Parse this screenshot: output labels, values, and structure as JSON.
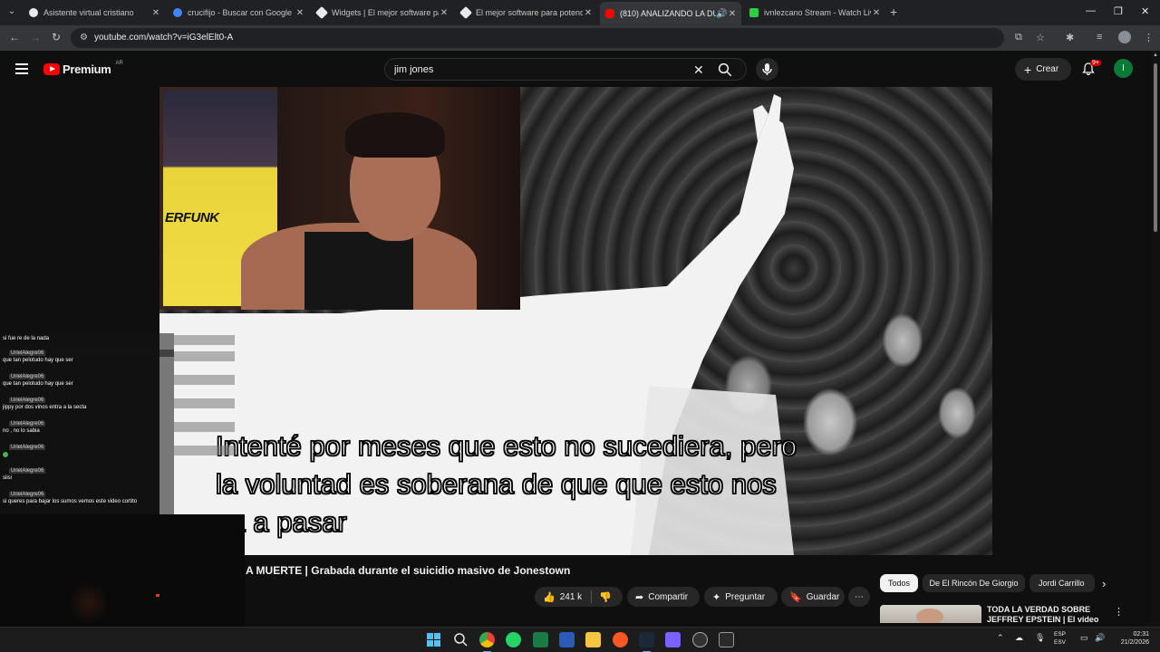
{
  "browser": {
    "tabs": [
      {
        "title": "Asistente virtual cristiano",
        "favicon_color": "#e8eaed"
      },
      {
        "title": "crucifijo - Buscar con Google",
        "favicon_color": "#4285f4"
      },
      {
        "title": "Widgets | El mejor software pa",
        "favicon_color": "#e8eaed"
      },
      {
        "title": "El mejor software para potencia",
        "favicon_color": "#e8eaed"
      },
      {
        "title": "(810) ANALIZANDO LA DU",
        "favicon_color": "#ff0000"
      },
      {
        "title": "ivnlezcano Stream - Watch Live",
        "favicon_color": "#2ecc40"
      }
    ],
    "new_tab": "+",
    "url": "youtube.com/watch?v=iG3elElt0-A"
  },
  "header": {
    "logo_text": "Premium",
    "country": "AR",
    "search_value": "jim jones",
    "create_label": "Crear",
    "notifications_badge": "9+",
    "avatar_letter": "I"
  },
  "player": {
    "overlay_brand": "ERFUNK",
    "subtitle_lines": [
      "Intenté por meses que esto no sucediera, pero",
      "la voluntad es soberana de que que esto nos",
      "va a pasar"
    ]
  },
  "chat": {
    "first_message": "si fue re de la nada",
    "messages": [
      {
        "user": "UrielAlegre06",
        "text": "que tan pelotudo hay que ser"
      },
      {
        "user": "UrielAlegre06",
        "text": "que tan pelotudo hay que ser"
      },
      {
        "user": "UrielAlegre06",
        "text": "jippy por dos vinos entra a la secta"
      },
      {
        "user": "UrielAlegre06",
        "text": "no , no lo sabia"
      },
      {
        "user": "UrielAlegre06",
        "text": ""
      },
      {
        "user": "UrielAlegre06",
        "text": "siisi"
      },
      {
        "user": "UrielAlegre06",
        "text": "si queres para bajar los sumos vemos este video cortito"
      }
    ]
  },
  "video": {
    "title": "A MUERTE | Grabada durante el suicidio masivo de Jonestown",
    "likes": "241 k",
    "share_label": "Compartir",
    "ask_label": "Preguntar",
    "save_label": "Guardar"
  },
  "sidebar": {
    "chips": [
      "Todos",
      "De El Rincón De Giorgio",
      "Jordi Carrillo"
    ],
    "recommendation_title": "TODA LA VERDAD SOBRE JEFFREY EPSTEIN | El video"
  },
  "taskbar": {
    "lang_top": "ESP",
    "lang_bottom": "ESV",
    "time": "02:31",
    "date": "21/2/2026"
  },
  "colors": {
    "brand_red": "#ff0000",
    "avatar_green": "#0b7a37",
    "background": "#0f0f0f"
  }
}
